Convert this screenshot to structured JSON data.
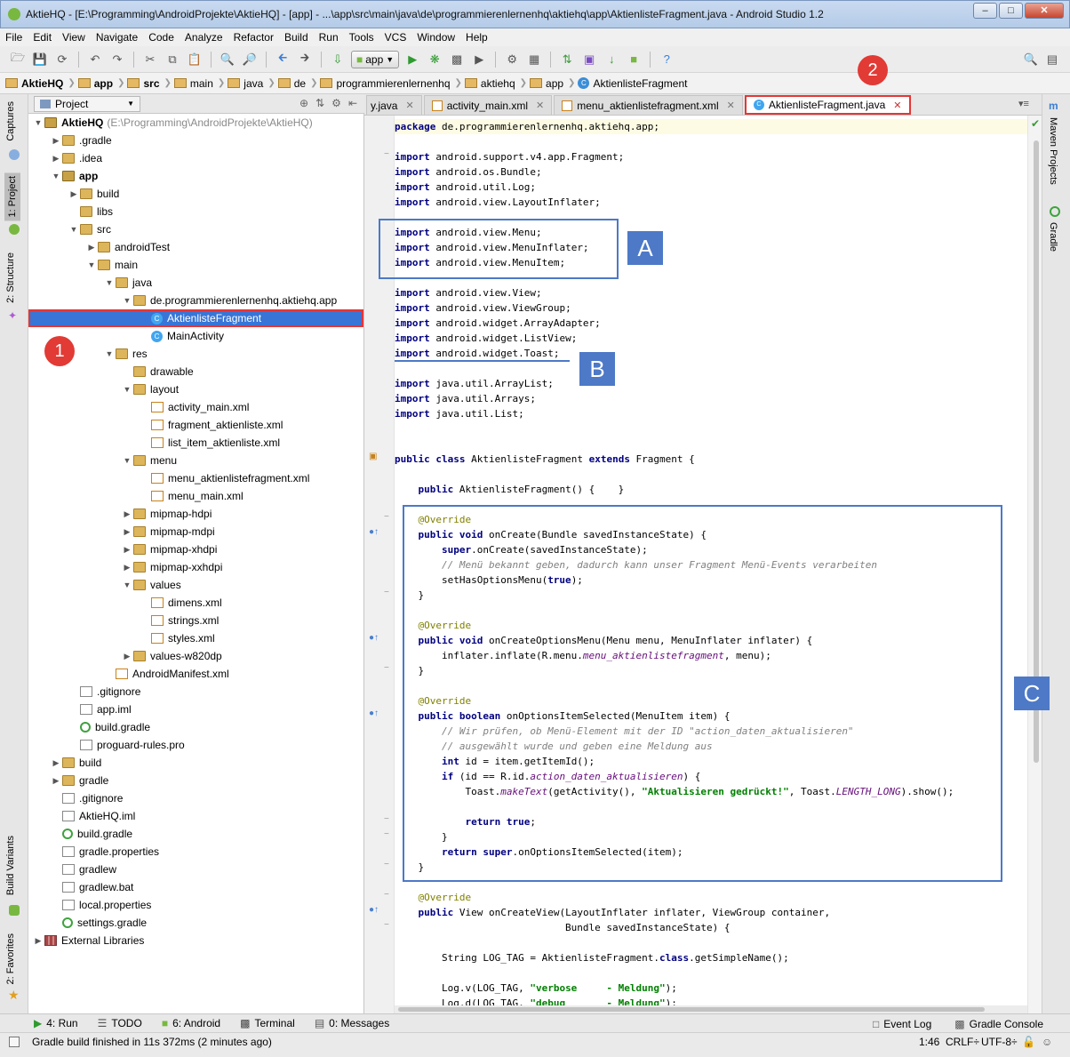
{
  "window": {
    "title": "AktieHQ - [E:\\Programming\\AndroidProjekte\\AktieHQ] - [app] - ...\\app\\src\\main\\java\\de\\programmierenlernenhq\\aktiehq\\app\\AktienlisteFragment.java - Android Studio 1.2"
  },
  "menu": [
    "File",
    "Edit",
    "View",
    "Navigate",
    "Code",
    "Analyze",
    "Refactor",
    "Build",
    "Run",
    "Tools",
    "VCS",
    "Window",
    "Help"
  ],
  "toolbar": {
    "run_config": "app"
  },
  "breadcrumb": [
    "AktieHQ",
    "app",
    "src",
    "main",
    "java",
    "de",
    "programmierenlernenhq",
    "aktiehq",
    "app",
    "AktienlisteFragment"
  ],
  "left_tool_windows": [
    "Captures",
    "1: Project",
    "2: Structure",
    "Build Variants",
    "2: Favorites"
  ],
  "right_tool_windows": [
    "Maven Projects",
    "Gradle"
  ],
  "project_panel": {
    "view": "Project"
  },
  "tree": [
    {
      "label": "AktieHQ",
      "suffix": "(E:\\Programming\\AndroidProjekte\\AktieHQ)",
      "d": 0,
      "t": "v",
      "i": "folderb",
      "b": true
    },
    {
      "label": ".gradle",
      "d": 1,
      "t": ">",
      "i": "folder"
    },
    {
      "label": ".idea",
      "d": 1,
      "t": ">",
      "i": "folder"
    },
    {
      "label": "app",
      "d": 1,
      "t": "v",
      "i": "folderb",
      "b": true
    },
    {
      "label": "build",
      "d": 2,
      "t": ">",
      "i": "folder"
    },
    {
      "label": "libs",
      "d": 2,
      "t": "",
      "i": "folder"
    },
    {
      "label": "src",
      "d": 2,
      "t": "v",
      "i": "folder"
    },
    {
      "label": "androidTest",
      "d": 3,
      "t": ">",
      "i": "folder"
    },
    {
      "label": "main",
      "d": 3,
      "t": "v",
      "i": "folder"
    },
    {
      "label": "java",
      "d": 4,
      "t": "v",
      "i": "folder"
    },
    {
      "label": "de.programmierenlernenhq.aktiehq.app",
      "d": 5,
      "t": "v",
      "i": "folder"
    },
    {
      "label": "AktienlisteFragment",
      "d": 6,
      "t": "",
      "i": "cls",
      "sel": true
    },
    {
      "label": "MainActivity",
      "d": 6,
      "t": "",
      "i": "cls"
    },
    {
      "label": "res",
      "d": 4,
      "t": "v",
      "i": "folder"
    },
    {
      "label": "drawable",
      "d": 5,
      "t": "",
      "i": "folder"
    },
    {
      "label": "layout",
      "d": 5,
      "t": "v",
      "i": "folder"
    },
    {
      "label": "activity_main.xml",
      "d": 6,
      "t": "",
      "i": "xml"
    },
    {
      "label": "fragment_aktienliste.xml",
      "d": 6,
      "t": "",
      "i": "xml"
    },
    {
      "label": "list_item_aktienliste.xml",
      "d": 6,
      "t": "",
      "i": "xml"
    },
    {
      "label": "menu",
      "d": 5,
      "t": "v",
      "i": "folder"
    },
    {
      "label": "menu_aktienlistefragment.xml",
      "d": 6,
      "t": "",
      "i": "xml"
    },
    {
      "label": "menu_main.xml",
      "d": 6,
      "t": "",
      "i": "xml"
    },
    {
      "label": "mipmap-hdpi",
      "d": 5,
      "t": ">",
      "i": "folder"
    },
    {
      "label": "mipmap-mdpi",
      "d": 5,
      "t": ">",
      "i": "folder"
    },
    {
      "label": "mipmap-xhdpi",
      "d": 5,
      "t": ">",
      "i": "folder"
    },
    {
      "label": "mipmap-xxhdpi",
      "d": 5,
      "t": ">",
      "i": "folder"
    },
    {
      "label": "values",
      "d": 5,
      "t": "v",
      "i": "folder"
    },
    {
      "label": "dimens.xml",
      "d": 6,
      "t": "",
      "i": "xml"
    },
    {
      "label": "strings.xml",
      "d": 6,
      "t": "",
      "i": "xml"
    },
    {
      "label": "styles.xml",
      "d": 6,
      "t": "",
      "i": "xml"
    },
    {
      "label": "values-w820dp",
      "d": 5,
      "t": ">",
      "i": "folder"
    },
    {
      "label": "AndroidManifest.xml",
      "d": 4,
      "t": "",
      "i": "xml"
    },
    {
      "label": ".gitignore",
      "d": 2,
      "t": "",
      "i": "file"
    },
    {
      "label": "app.iml",
      "d": 2,
      "t": "",
      "i": "file"
    },
    {
      "label": "build.gradle",
      "d": 2,
      "t": "",
      "i": "grad"
    },
    {
      "label": "proguard-rules.pro",
      "d": 2,
      "t": "",
      "i": "file"
    },
    {
      "label": "build",
      "d": 1,
      "t": ">",
      "i": "folder"
    },
    {
      "label": "gradle",
      "d": 1,
      "t": ">",
      "i": "folder"
    },
    {
      "label": ".gitignore",
      "d": 1,
      "t": "",
      "i": "file"
    },
    {
      "label": "AktieHQ.iml",
      "d": 1,
      "t": "",
      "i": "file"
    },
    {
      "label": "build.gradle",
      "d": 1,
      "t": "",
      "i": "grad"
    },
    {
      "label": "gradle.properties",
      "d": 1,
      "t": "",
      "i": "file"
    },
    {
      "label": "gradlew",
      "d": 1,
      "t": "",
      "i": "file"
    },
    {
      "label": "gradlew.bat",
      "d": 1,
      "t": "",
      "i": "file"
    },
    {
      "label": "local.properties",
      "d": 1,
      "t": "",
      "i": "file"
    },
    {
      "label": "settings.gradle",
      "d": 1,
      "t": "",
      "i": "grad"
    },
    {
      "label": "External Libraries",
      "d": 0,
      "t": ">",
      "i": "lib"
    }
  ],
  "tabs": [
    {
      "label": "y.java",
      "icon": "none"
    },
    {
      "label": "activity_main.xml",
      "icon": "xml"
    },
    {
      "label": "menu_aktienlistefragment.xml",
      "icon": "xml"
    },
    {
      "label": "AktienlisteFragment.java",
      "icon": "cls",
      "active": true
    }
  ],
  "code": [
    [
      1,
      "p",
      "package de.programmierenlernenhq.aktiehq.app;"
    ],
    [
      3,
      "p",
      "import android.support.v4.app.Fragment;"
    ],
    [
      4,
      "p",
      "import android.os.Bundle;"
    ],
    [
      5,
      "p",
      "import android.util.Log;"
    ],
    [
      6,
      "p",
      "import android.view.LayoutInflater;"
    ],
    [
      8,
      "p",
      "import android.view.Menu;"
    ],
    [
      9,
      "p",
      "import android.view.MenuInflater;"
    ],
    [
      10,
      "p",
      "import android.view.MenuItem;"
    ],
    [
      12,
      "p",
      "import android.view.View;"
    ],
    [
      13,
      "p",
      "import android.view.ViewGroup;"
    ],
    [
      14,
      "p",
      "import android.widget.ArrayAdapter;"
    ],
    [
      15,
      "p",
      "import android.widget.ListView;"
    ],
    [
      16,
      "p",
      "import android.widget.Toast;"
    ],
    [
      18,
      "p",
      "import java.util.ArrayList;"
    ],
    [
      19,
      "p",
      "import java.util.Arrays;"
    ],
    [
      20,
      "p",
      "import java.util.List;"
    ],
    [
      23,
      "p",
      "public class AktienlisteFragment extends Fragment {"
    ],
    [
      25,
      "p",
      "    public AktienlisteFragment() {    }"
    ],
    [
      27,
      "a",
      "    @Override"
    ],
    [
      28,
      "p",
      "    public void onCreate(Bundle savedInstanceState) {"
    ],
    [
      29,
      "p",
      "        super.onCreate(savedInstanceState);"
    ],
    [
      30,
      "c",
      "        // Menü bekannt geben, dadurch kann unser Fragment Menü-Events verarbeiten"
    ],
    [
      31,
      "p",
      "        setHasOptionsMenu(true);"
    ],
    [
      32,
      "p",
      "    }"
    ],
    [
      34,
      "a",
      "    @Override"
    ],
    [
      35,
      "p",
      "    public void onCreateOptionsMenu(Menu menu, MenuInflater inflater) {"
    ],
    [
      36,
      "p",
      "        inflater.inflate(R.menu.menu_aktienlistefragment, menu);"
    ],
    [
      37,
      "p",
      "    }"
    ],
    [
      39,
      "a",
      "    @Override"
    ],
    [
      40,
      "p",
      "    public boolean onOptionsItemSelected(MenuItem item) {"
    ],
    [
      41,
      "c",
      "        // Wir prüfen, ob Menü-Element mit der ID \"action_daten_aktualisieren\""
    ],
    [
      42,
      "c",
      "        // ausgewählt wurde und geben eine Meldung aus"
    ],
    [
      43,
      "p",
      "        int id = item.getItemId();"
    ],
    [
      44,
      "p",
      "        if (id == R.id.action_daten_aktualisieren) {"
    ],
    [
      45,
      "p",
      "            Toast.makeText(getActivity(), \"Aktualisieren gedrückt!\", Toast.LENGTH_LONG).show();"
    ],
    [
      47,
      "p",
      "            return true;"
    ],
    [
      48,
      "p",
      "        }"
    ],
    [
      49,
      "p",
      "        return super.onOptionsItemSelected(item);"
    ],
    [
      50,
      "p",
      "    }"
    ],
    [
      52,
      "a",
      "    @Override"
    ],
    [
      53,
      "p",
      "    public View onCreateView(LayoutInflater inflater, ViewGroup container,"
    ],
    [
      54,
      "p",
      "                             Bundle savedInstanceState) {"
    ],
    [
      56,
      "p",
      "        String LOG_TAG = AktienlisteFragment.class.getSimpleName();"
    ],
    [
      58,
      "p",
      "        Log.v(LOG_TAG, \"verbose     - Meldung\");"
    ],
    [
      59,
      "p",
      "        Log.d(LOG_TAG, \"debug       - Meldung\");"
    ]
  ],
  "annotations": {
    "box_a": "A",
    "box_b": "B",
    "box_c": "C",
    "marker_1": "1",
    "marker_2": "2"
  },
  "bottom_tools": [
    "4: Run",
    "TODO",
    "6: Android",
    "Terminal",
    "0: Messages"
  ],
  "bottom_right_tools": [
    "Event Log",
    "Gradle Console"
  ],
  "status": {
    "message": "Gradle build finished in 11s 372ms (2 minutes ago)",
    "position": "1:46",
    "line_sep": "CRLF÷",
    "encoding": "UTF-8÷"
  }
}
